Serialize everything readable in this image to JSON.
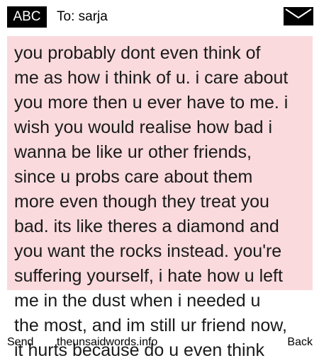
{
  "header": {
    "badge": "ABC",
    "to_prefix": "To:",
    "recipient": "sarja",
    "envelope_icon": "envelope-icon"
  },
  "message": {
    "lines": [
      "you probably dont even think of",
      "me as how i think of u. i care about",
      "you more then u ever have to me. i",
      "wish you would realise how bad i",
      "wanna be like ur other friends,",
      "since u probs care about them",
      "more even though they treat you",
      "bad. its like theres a diamond and",
      "you want the rocks instead. you're",
      "suffering yourself, i hate how u left",
      "me in the dust when i needed u",
      "the most, and im still ur friend now,",
      "it hurts because do u even think"
    ]
  },
  "softkeys": {
    "left": "Send",
    "center": "theunsaidwords.info",
    "right": "Back"
  },
  "colors": {
    "panel": "#fadadd",
    "badge_bg": "#000000",
    "badge_fg": "#ffffff"
  }
}
